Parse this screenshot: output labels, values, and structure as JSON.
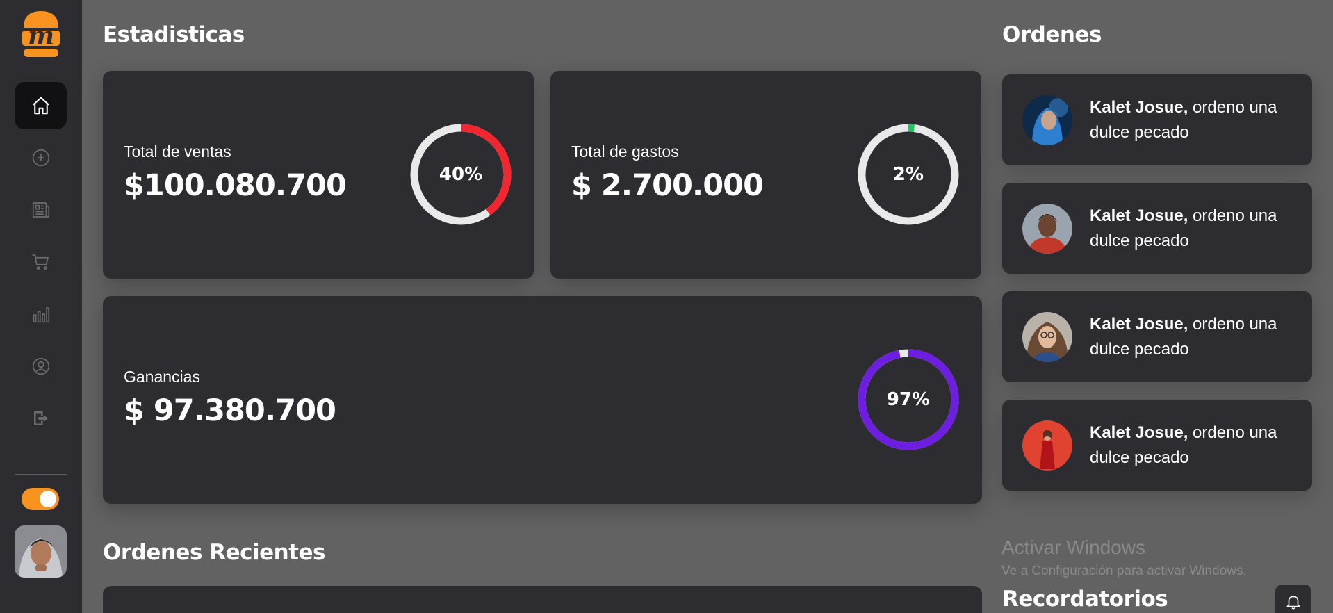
{
  "sidebar": {
    "nav_icons": [
      "home-icon",
      "add-circle-icon",
      "newspaper-icon",
      "cart-icon",
      "bar-chart-icon",
      "user-circle-icon",
      "logout-icon"
    ],
    "active_item": "home-icon",
    "theme_toggle_on": true,
    "accent_color": "#f7931e"
  },
  "stats": {
    "title": "Estadisticas",
    "sales": {
      "label": "Total de ventas",
      "value": "$100.080.700",
      "percent_label": "40%",
      "percent": 40,
      "color": "#f2262e"
    },
    "expenses": {
      "label": "Total de gastos",
      "value": "$ 2.700.000",
      "percent_label": "2%",
      "percent": 2,
      "color": "#22c55e"
    },
    "profit": {
      "label": "Ganancias",
      "value": "$ 97.380.700",
      "percent_label": "97%",
      "percent": 97,
      "color": "#6d1ee0"
    }
  },
  "orders": {
    "title": "Ordenes",
    "items": [
      {
        "name": "Kalet Josue,",
        "text": " ordeno una dulce pecado"
      },
      {
        "name": "Kalet Josue,",
        "text": " ordeno una dulce pecado"
      },
      {
        "name": "Kalet Josue,",
        "text": " ordeno una dulce pecado"
      },
      {
        "name": "Kalet Josue,",
        "text": " ordeno una dulce pecado"
      }
    ]
  },
  "recent": {
    "title": "Ordenes Recientes"
  },
  "reminders": {
    "title": "Recordatorios"
  },
  "watermark": {
    "title": "Activar Windows",
    "subtitle": "Ve a Configuración para activar Windows."
  }
}
